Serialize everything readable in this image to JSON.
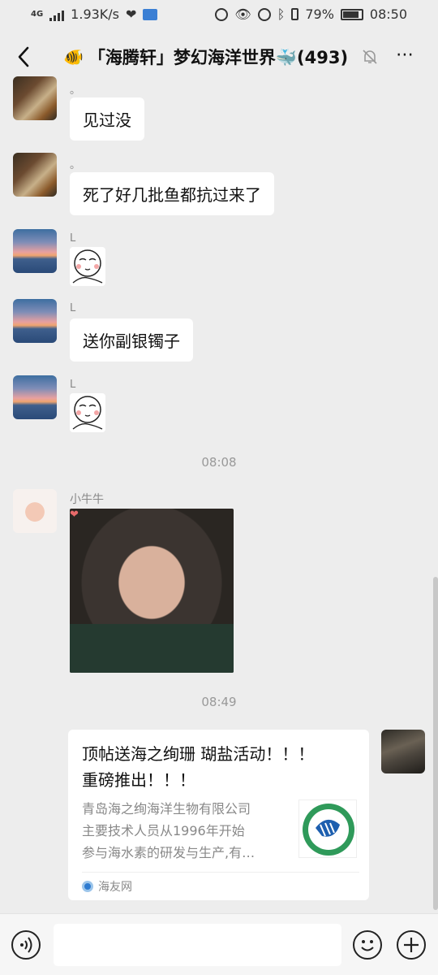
{
  "status_bar": {
    "network_type": "4G",
    "speed": "1.93K/s",
    "battery": "79%",
    "time": "08:50"
  },
  "header": {
    "title": "「海腾轩」梦幻海洋世界🐳(493)",
    "title_emoji": "🐠"
  },
  "messages": [
    {
      "sender": "。",
      "text": "见过没",
      "avatar": "eagle"
    },
    {
      "sender": "。",
      "text": "死了好几批鱼都抗过来了",
      "avatar": "eagle"
    },
    {
      "sender": "L",
      "type": "sticker",
      "avatar": "whale"
    },
    {
      "sender": "L",
      "text": "送你副银镯子",
      "avatar": "whale"
    },
    {
      "sender": "L",
      "type": "sticker",
      "avatar": "whale"
    }
  ],
  "time_separators": [
    "08:08",
    "08:49"
  ],
  "photo_message": {
    "sender": "小牛牛"
  },
  "link_card": {
    "title_line1": "顶帖送海之绚珊 瑚盐活动！！！",
    "title_line2": "重磅推出！！！",
    "desc_line1": "青岛海之绚海洋生物有限公司",
    "desc_line2": "主要技术人员从1996年开始",
    "desc_line3": "参与海水素的研发与生产,有…",
    "source": "海友网"
  },
  "colors": {
    "background": "#ededed",
    "bubble": "#ffffff",
    "meta_text": "#888888"
  }
}
